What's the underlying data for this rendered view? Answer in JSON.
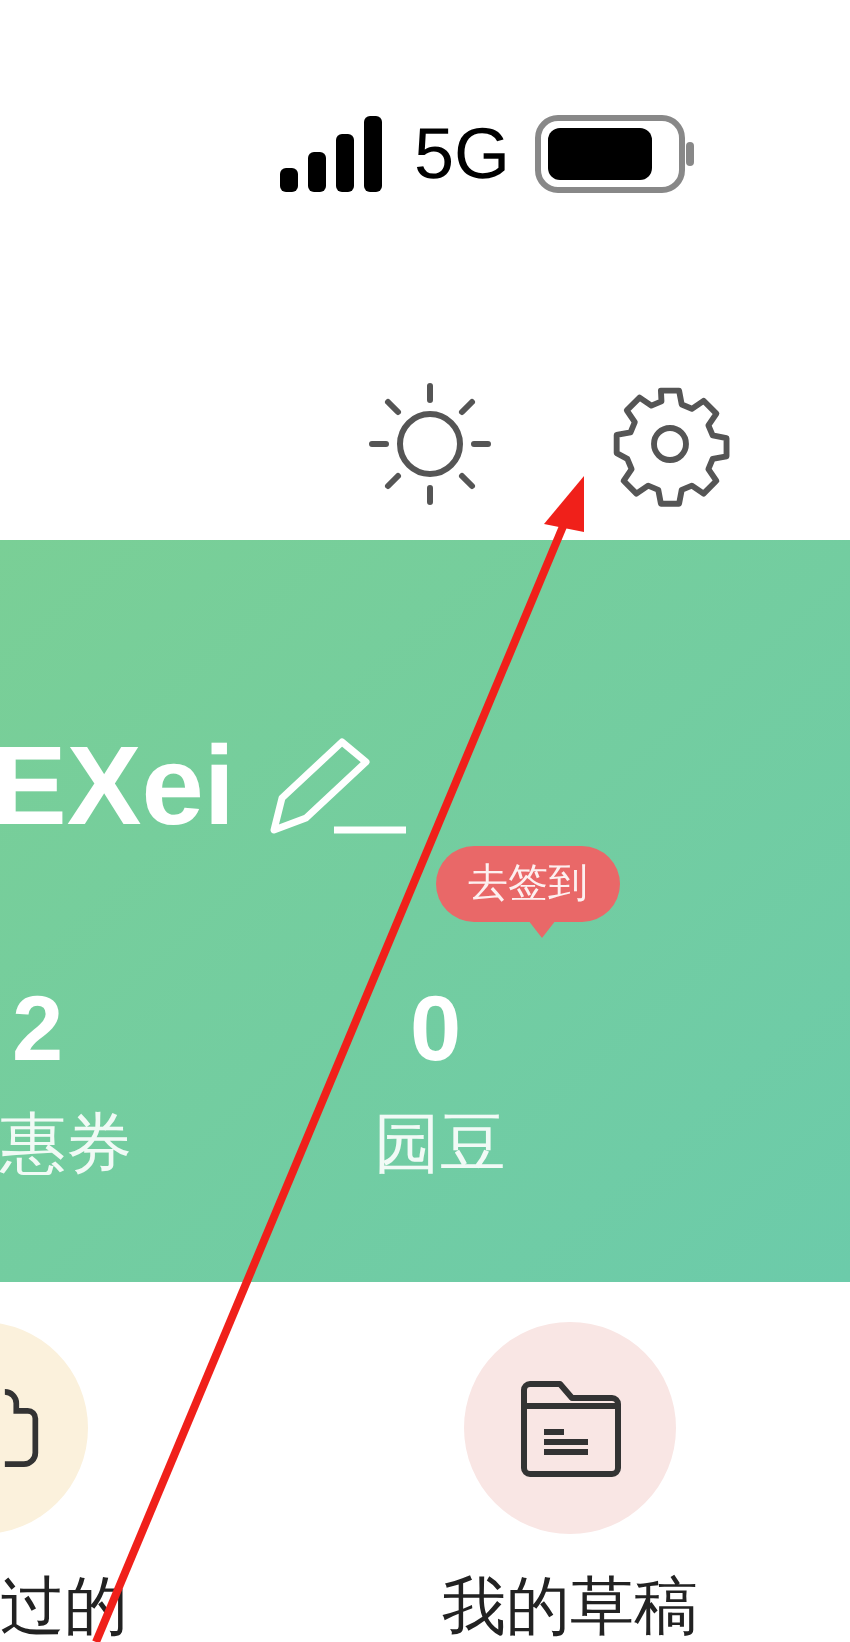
{
  "status_bar": {
    "network": "5G"
  },
  "profile": {
    "name": "EXei",
    "stats": [
      {
        "value": "2",
        "label": "惠券"
      },
      {
        "value": "0",
        "label": "园豆",
        "badge": "去签到"
      }
    ]
  },
  "shortcuts": [
    {
      "label": "过的",
      "kind": "bag"
    },
    {
      "label": "我的草稿",
      "kind": "folder"
    }
  ]
}
